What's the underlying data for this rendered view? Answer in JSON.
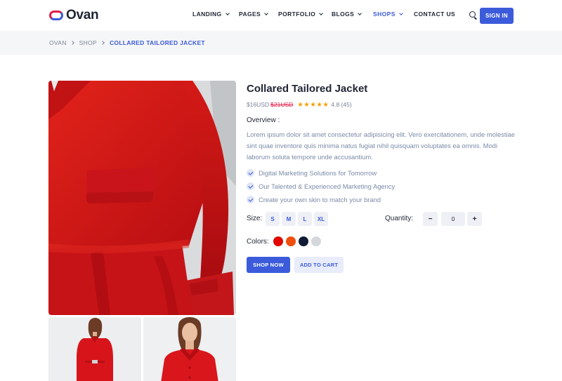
{
  "brand": {
    "name": "Ovan"
  },
  "nav": {
    "items": [
      {
        "label": "LANDING",
        "dropdown": true,
        "active": false
      },
      {
        "label": "PAGES",
        "dropdown": true,
        "active": false
      },
      {
        "label": "PORTFOLIO",
        "dropdown": true,
        "active": false
      },
      {
        "label": "BLOGS",
        "dropdown": true,
        "active": false
      },
      {
        "label": "SHOPS",
        "dropdown": true,
        "active": true
      },
      {
        "label": "CONTACT US",
        "dropdown": false,
        "active": false
      }
    ],
    "signin_label": "SIGN IN"
  },
  "breadcrumb": [
    "OVAN",
    "SHOP",
    "COLLARED TAILORED JACKET"
  ],
  "product": {
    "title": "Collared Tailored Jacket",
    "price": "$16USD",
    "old_price": "$21USD",
    "stars": 5,
    "rating": "4.8 (45)",
    "overview_label": "Overview :",
    "description": "Lorem ipsum dolor sit amet consectetur adipisicing elit. Vero exercitationem, unde molestiae sint quae inventore quis minima natus fugiat nihil quisquam voluptates ea omnis. Modi laborum soluta tempore unde accusantium.",
    "features": [
      "Digital Marketing Solutions for Tomorrow",
      "Our Talented & Experienced Marketing Agency",
      "Create your own skin to match your brand"
    ],
    "size_label": "Size:",
    "sizes": [
      "S",
      "M",
      "L",
      "XL"
    ],
    "quantity_label": "Quantity:",
    "quantity": "0",
    "minus": "−",
    "plus": "+",
    "colors_label": "Colors:",
    "colors": [
      "#e10600",
      "#f04e0c",
      "#101c36",
      "#d4d7dc"
    ],
    "buy_label": "SHOP NOW",
    "cart_label": "ADD TO CART"
  },
  "theme": {
    "accent": "#3b5bdb",
    "sale": "#e11d48",
    "star": "#f59f00"
  }
}
